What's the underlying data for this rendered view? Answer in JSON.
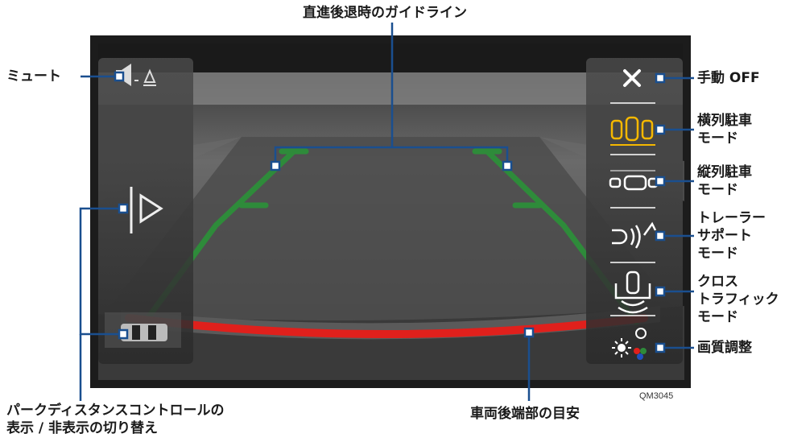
{
  "labels": {
    "guide_line": "直進後退時のガイドライン",
    "mute": "ミュート",
    "manual_off": "手動 OFF",
    "parallel_parking": [
      "横列駐車",
      "モード"
    ],
    "tandem_parking": [
      "縦列駐車",
      "モード"
    ],
    "trailer_support": [
      "トレーラー",
      "サポート",
      "モード"
    ],
    "cross_traffic": [
      "クロス",
      "トラフィック",
      "モード"
    ],
    "image_quality": "画質調整",
    "park_distance_toggle": [
      "パークディスタンスコントロールの",
      "表示 / 非表示の切り替え"
    ],
    "vehicle_rear_end": "車両後端部の目安"
  },
  "figure_code": "QM3045",
  "icons": {
    "mute": "speaker-mute-icon",
    "close": "close-x-icon",
    "parallel": "parallel-parking-icon",
    "tandem": "tandem-parking-icon",
    "trailer": "trailer-support-icon",
    "cross": "cross-traffic-icon",
    "quality": "image-quality-icon",
    "toggle": "play-toggle-icon",
    "sensor": "park-distance-sensor-icon"
  },
  "colors": {
    "accent_yellow": "#f5b800",
    "guide_green": "#2e8b3a",
    "rear_red": "#e0201c",
    "callout_blue": "#1a4f8f"
  }
}
